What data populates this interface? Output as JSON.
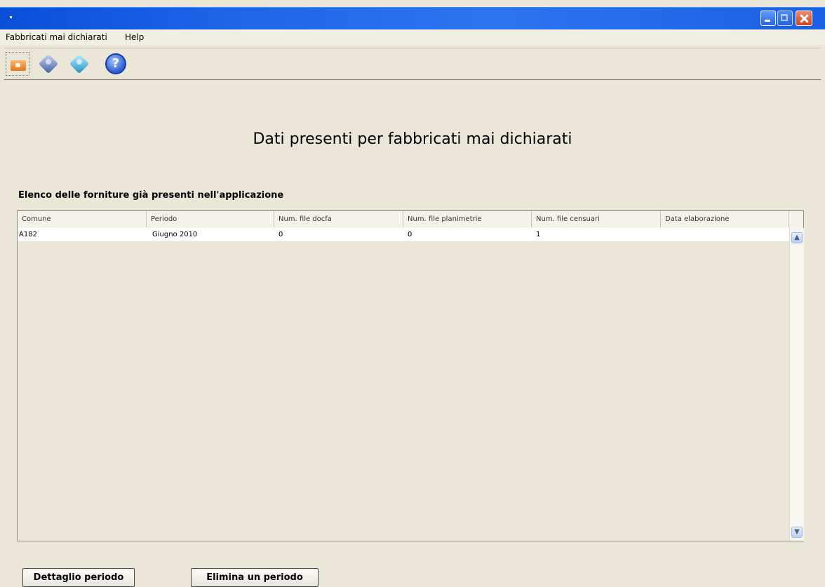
{
  "menu": {
    "items": [
      "Fabbricati mai dichiarati",
      "Help"
    ]
  },
  "toolbar": {
    "icons": [
      "open-folder-icon",
      "diamond-blue-dark-icon",
      "diamond-blue-light-icon",
      "help-icon"
    ],
    "help_glyph": "?"
  },
  "main": {
    "title": "Dati presenti per fabbricati mai dichiarati",
    "subtitle": "Elenco delle forniture già presenti nell'applicazione"
  },
  "table": {
    "columns": [
      "Comune",
      "Periodo",
      "Num. file docfa",
      "Num. file planimetrie",
      "Num. file censuari",
      "Data elaborazione"
    ],
    "rows": [
      [
        "A182",
        "Giugno 2010",
        "0",
        "0",
        "1",
        ""
      ]
    ]
  },
  "buttons": {
    "detail": "Dettaglio periodo",
    "delete": "Elimina un periodo"
  },
  "colors": {
    "titlebar": "#1f66e8",
    "background": "#ebe7d8",
    "close_button": "#d2421c"
  }
}
